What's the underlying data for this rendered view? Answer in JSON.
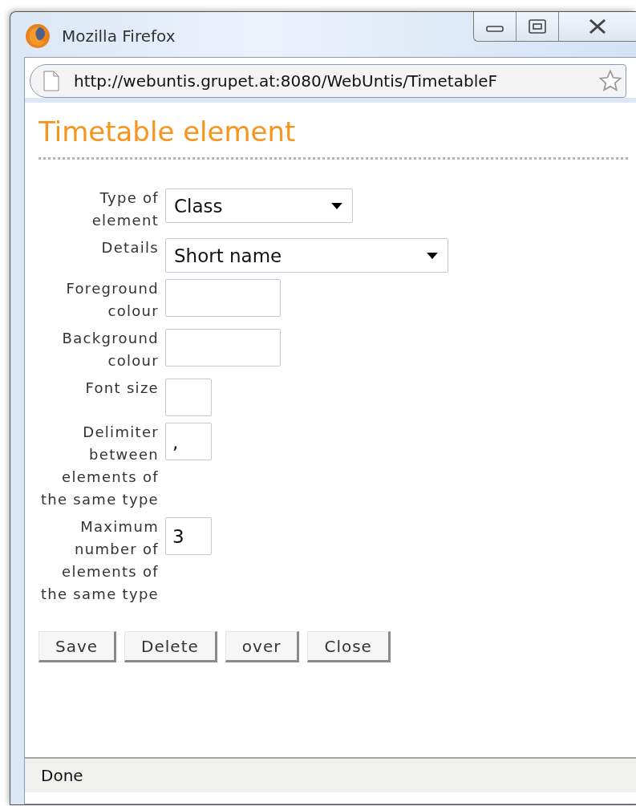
{
  "window": {
    "title": "Mozilla Firefox"
  },
  "address_bar": {
    "url": "http://webuntis.grupet.at:8080/WebUntis/TimetableF"
  },
  "heading": "Timetable element",
  "form": {
    "fields": [
      {
        "label": "Type of element",
        "kind": "select",
        "value": "Class"
      },
      {
        "label": "Details",
        "kind": "wideselect",
        "value": "Short name"
      },
      {
        "label": "Foreground colour",
        "kind": "input"
      },
      {
        "label": "Background colour",
        "kind": "input"
      },
      {
        "label": "Font size",
        "kind": "shortinput"
      },
      {
        "label": "Delimiter between elements of the same type",
        "kind": "shortinput",
        "value": ","
      },
      {
        "label": "Maximum number of elements of the same type",
        "kind": "shortinput",
        "value": "3"
      }
    ]
  },
  "buttons": [
    "Save",
    "Delete",
    "over",
    "Close"
  ],
  "status_bar": "Done"
}
